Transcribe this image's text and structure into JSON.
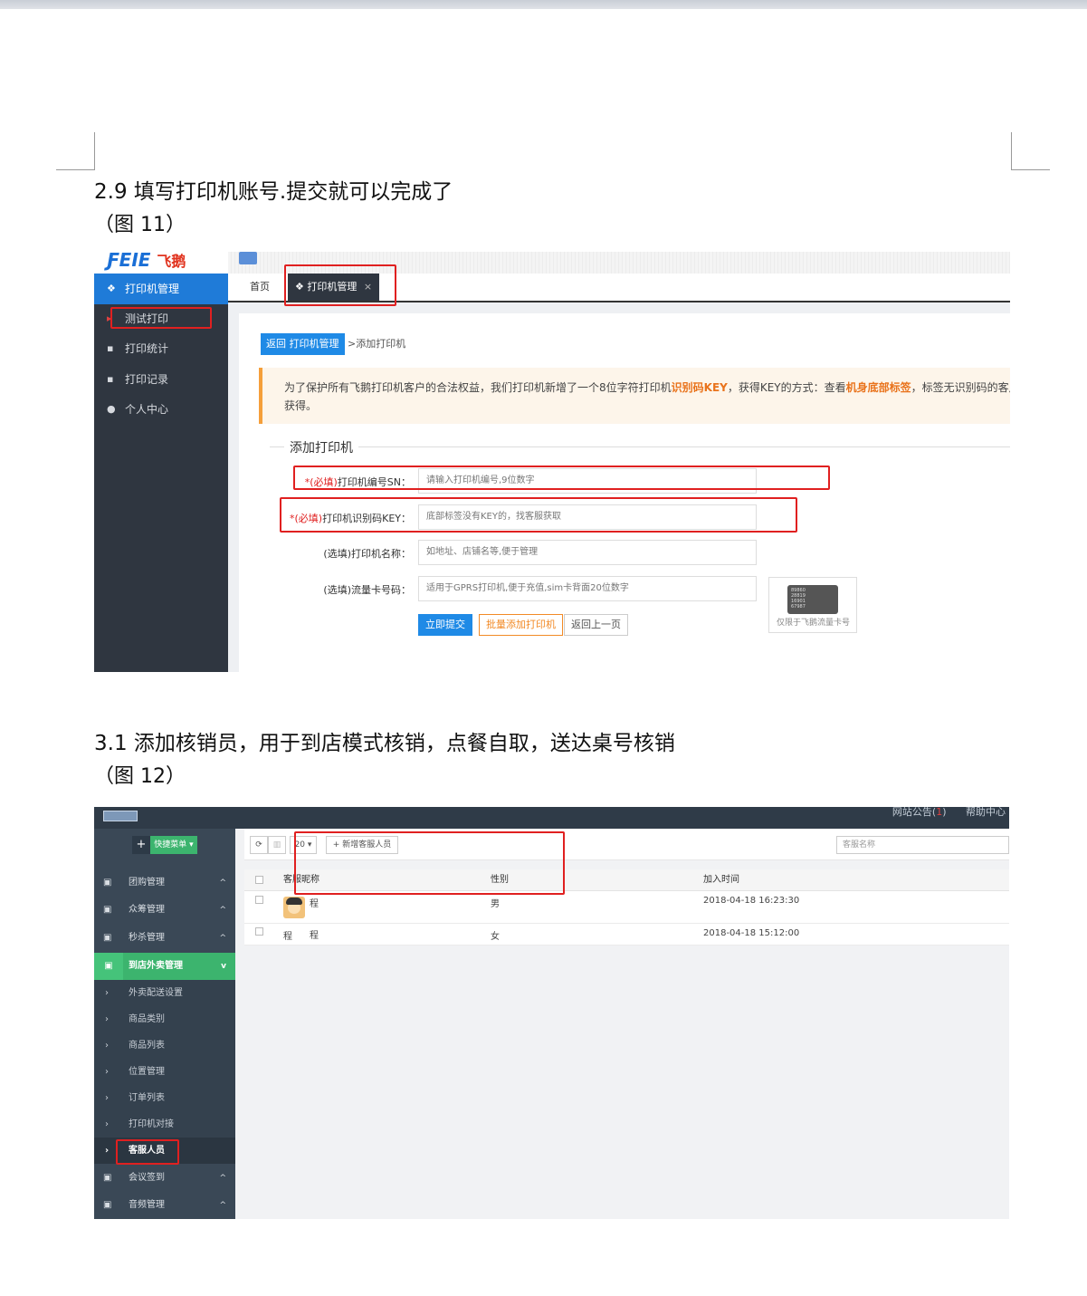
{
  "section1": {
    "heading": "2.9 填写打印机账号.提交就可以完成了",
    "caption": "（图 11）",
    "screenshot": {
      "logo_en": "ƑEIE",
      "logo_cn": "飞鹅",
      "sidebar_items": [
        "打印机管理",
        "测试打印",
        "打印统计",
        "打印记录",
        "个人中心"
      ],
      "tabs": [
        "首页",
        "打印机管理"
      ],
      "tab_close": "×",
      "back_button": "返回 打印机管理",
      "breadcrumb": ">添加打印机",
      "notice_pre": "为了保护所有飞鹅打印机客户的合法权益，我们打印机新增了一个8位字符打印机",
      "notice_key": "识别码KEY",
      "notice_mid": "，获得KEY的方式：查看",
      "notice_label": "机身底部标签",
      "notice_post": "，标签无识别码的客户",
      "notice_line2": "获得。",
      "legend": "添加打印机",
      "fields": [
        {
          "req": "*(必填)",
          "label": "打印机编号SN：",
          "placeholder": "请输入打印机编号,9位数字"
        },
        {
          "req": "*(必填)",
          "label": "打印机识别码KEY：",
          "placeholder": "底部标签没有KEY的，找客服获取"
        },
        {
          "req": "",
          "label": "(选填)打印机名称：",
          "placeholder": "如地址、店铺名等,便于管理"
        },
        {
          "req": "",
          "label": "(选填)流量卡号码：",
          "placeholder": "适用于GPRS打印机,便于充值,sim卡背面20位数字"
        }
      ],
      "btn_submit": "立即提交",
      "btn_batch": "批量添加打印机",
      "btn_back": "返回上一页",
      "sim_numbers": [
        "89860",
        "28819",
        "16901",
        "67987"
      ],
      "sim_note": "仅限于飞鹅流量卡号"
    }
  },
  "section2": {
    "heading": "3.1 添加核销员，用于到店模式核销，点餐自取，送达桌号核销",
    "caption": "（图 12）",
    "screenshot": {
      "top_notice": "网站公告(",
      "top_notice_count": "1",
      "top_notice_close": ")",
      "top_help": "帮助中心",
      "quick_plus": "+",
      "quick_menu": "快捷菜单 ▾",
      "groups_top": [
        "团购管理",
        "众筹管理",
        "秒杀管理"
      ],
      "active_group": "到店外卖管理",
      "sub_items": [
        "外卖配送设置",
        "商品类别",
        "商品列表",
        "位置管理",
        "订单列表",
        "打印机对接",
        "客服人员"
      ],
      "groups_bottom": [
        "会议签到",
        "音频管理"
      ],
      "page_size": "20 ▾",
      "add_button": "+ 新增客服人员",
      "search_placeholder": "客服名称",
      "columns": [
        "客服昵称",
        "性别",
        "加入时间"
      ],
      "rows": [
        {
          "name": "程",
          "gender": "男",
          "joined": "2018-04-18 16:23:30"
        },
        {
          "name_prefix": "程",
          "name": "程",
          "gender": "女",
          "joined": "2018-04-18 15:12:00"
        }
      ]
    }
  }
}
